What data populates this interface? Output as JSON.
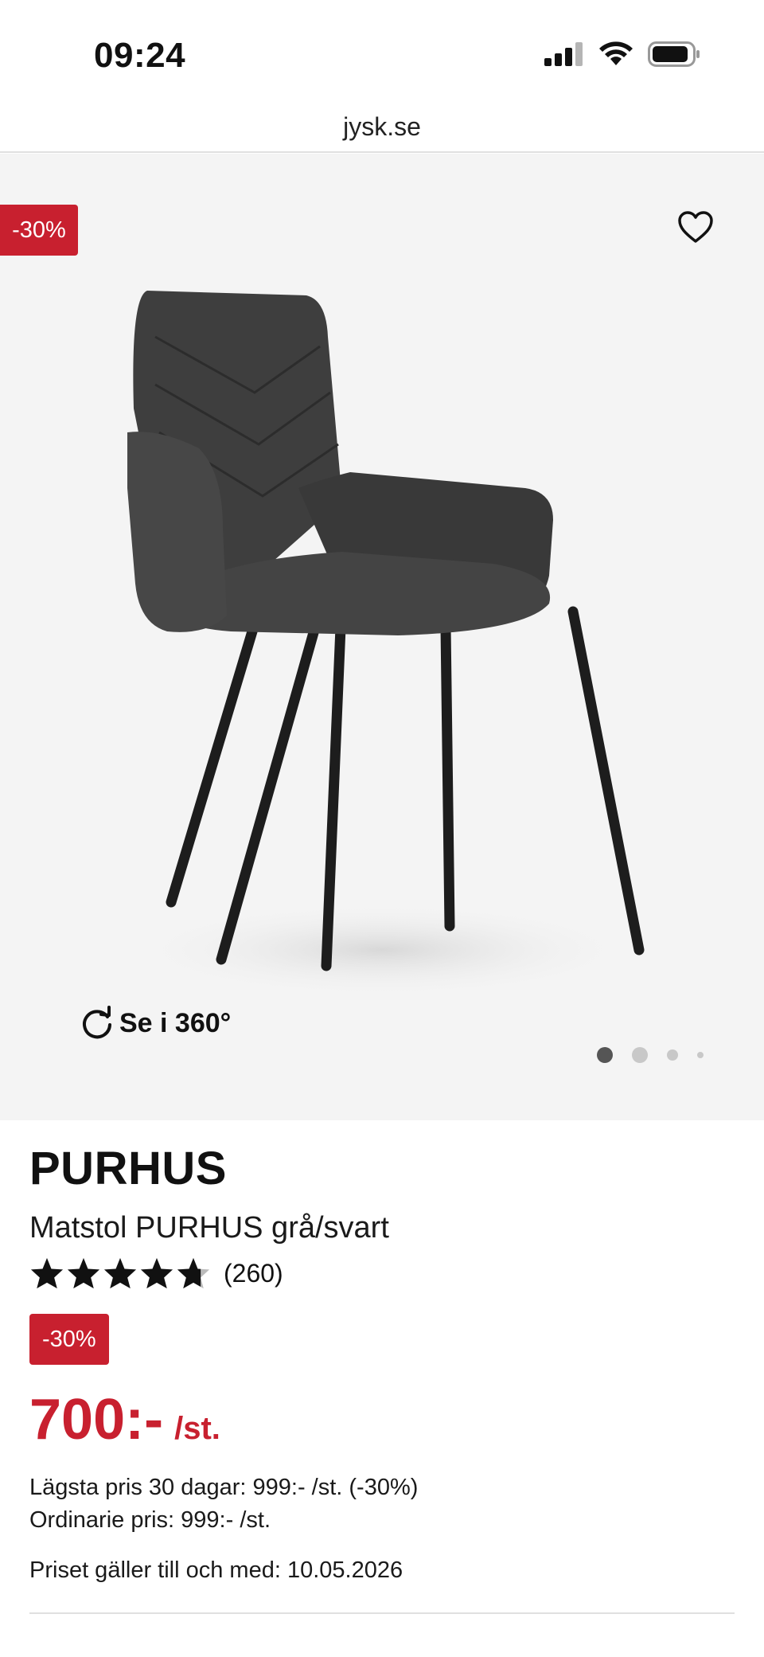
{
  "status_bar": {
    "time": "09:24",
    "icons": [
      "signal-icon",
      "wifi-icon",
      "battery-icon"
    ]
  },
  "browser": {
    "url": "jysk.se"
  },
  "gallery": {
    "discount_badge": "-30%",
    "spin_label": "Se i 360°",
    "favorite_icon": "heart-icon",
    "image_alt": "chair-image",
    "pagination": {
      "total": 4,
      "active": 1
    }
  },
  "product": {
    "brand": "PURHUS",
    "name": "Matstol PURHUS grå/svart",
    "rating": 4.7,
    "review_count": "(260)",
    "discount_badge": "-30%",
    "price": "700:-",
    "unit": "/st.",
    "lowest_price_30_days": "Lägsta pris 30 dagar: 999:- /st. (-30%)",
    "ordinary_price": "Ordinarie pris: 999:- /st.",
    "valid_until": "Priset gäller till och med: 10.05.2026"
  },
  "colors": {
    "accent": "#c8202f",
    "gallery_background": "#f4f4f4"
  }
}
